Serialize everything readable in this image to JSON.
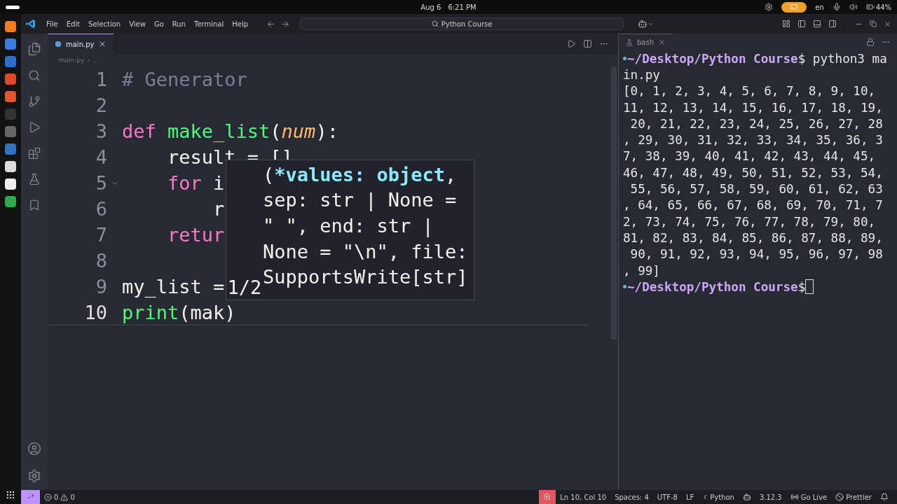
{
  "system_bar": {
    "date": "Aug 6",
    "time": "6:21 PM",
    "language": "en",
    "battery": "44%"
  },
  "menu": [
    "File",
    "Edit",
    "Selection",
    "View",
    "Go",
    "Run",
    "Terminal",
    "Help"
  ],
  "command_center": "Python Course",
  "editor": {
    "tabs": [
      {
        "label": "main.py",
        "selected": true
      }
    ],
    "breadcrumb": [
      "main.py",
      "›",
      "…"
    ],
    "lines": [
      {
        "number": "1",
        "tokens": [
          {
            "text": "# Generator",
            "kind": "comment"
          }
        ]
      },
      {
        "number": "2"
      },
      {
        "number": "3",
        "tokens": [
          {
            "text": "def ",
            "kind": "keyword"
          },
          {
            "text": "make_list",
            "kind": "function"
          },
          {
            "text": "(",
            "kind": "plain"
          },
          {
            "text": "num",
            "kind": "param"
          },
          {
            "text": "):",
            "kind": "plain"
          }
        ]
      },
      {
        "number": "4",
        "tokens": [
          {
            "text": "    result = []",
            "kind": "plain"
          }
        ]
      },
      {
        "number": "5",
        "fold": true,
        "tokens": [
          {
            "text": "    for ",
            "kind": "keyword"
          },
          {
            "text": "i",
            "kind": "plain"
          }
        ]
      },
      {
        "number": "6",
        "tokens": [
          {
            "text": "        r",
            "kind": "plain"
          }
        ]
      },
      {
        "number": "7",
        "tokens": [
          {
            "text": "    retur",
            "kind": "keyword"
          }
        ]
      },
      {
        "number": "8"
      },
      {
        "number": "9",
        "tokens": [
          {
            "text": "my_list =",
            "kind": "plain"
          }
        ]
      },
      {
        "number": "10",
        "current": true,
        "tokens": [
          {
            "text": "print",
            "kind": "function"
          },
          {
            "text": "(mak)",
            "kind": "plain"
          }
        ]
      }
    ],
    "hint": {
      "counter": "1/2",
      "lines": [
        [
          {
            "text": "(",
            "kind": "plain"
          },
          {
            "text": "*values: object",
            "kind": "active"
          },
          {
            "text": ",",
            "kind": "plain"
          }
        ],
        [
          {
            "text": "sep: str | None =",
            "kind": "plain"
          }
        ],
        [
          {
            "text": "\" \", end: str |",
            "kind": "plain"
          }
        ],
        [
          {
            "text": "None = \"\\n\", file:",
            "kind": "plain"
          }
        ],
        [
          {
            "text": "SupportsWrite[str]",
            "kind": "plain"
          }
        ]
      ]
    }
  },
  "terminal": {
    "tab": "bash",
    "lines": [
      {
        "kind": "prompt",
        "path": "~/Desktop/Python Course",
        "symbol": "$",
        "command": " python3 ma"
      },
      {
        "kind": "output",
        "text": "in.py"
      },
      {
        "kind": "output",
        "text": "[0, 1, 2, 3, 4, 5, 6, 7, 8, 9, 10,"
      },
      {
        "kind": "output",
        "text": "11, 12, 13, 14, 15, 16, 17, 18, 19,"
      },
      {
        "kind": "output",
        "text": " 20, 21, 22, 23, 24, 25, 26, 27, 28"
      },
      {
        "kind": "output",
        "text": ", 29, 30, 31, 32, 33, 34, 35, 36, 3"
      },
      {
        "kind": "output",
        "text": "7, 38, 39, 40, 41, 42, 43, 44, 45,"
      },
      {
        "kind": "output",
        "text": "46, 47, 48, 49, 50, 51, 52, 53, 54,"
      },
      {
        "kind": "output",
        "text": " 55, 56, 57, 58, 59, 60, 61, 62, 63"
      },
      {
        "kind": "output",
        "text": ", 64, 65, 66, 67, 68, 69, 70, 71, 7"
      },
      {
        "kind": "output",
        "text": "2, 73, 74, 75, 76, 77, 78, 79, 80,"
      },
      {
        "kind": "output",
        "text": "81, 82, 83, 84, 85, 86, 87, 88, 89,"
      },
      {
        "kind": "output",
        "text": " 90, 91, 92, 93, 94, 95, 96, 97, 98"
      },
      {
        "kind": "output",
        "text": ", 99]"
      },
      {
        "kind": "prompt",
        "path": "~/Desktop/Python Course",
        "symbol": "$",
        "cursor": true
      }
    ]
  },
  "status_bar": {
    "errors": "0",
    "warnings": "0",
    "items": [
      {
        "kind": "zoom"
      },
      {
        "kind": "text",
        "text": "Ln 10, Col 10"
      },
      {
        "kind": "text",
        "text": "Spaces: 4"
      },
      {
        "kind": "text",
        "text": "UTF-8"
      },
      {
        "kind": "text",
        "text": "LF"
      },
      {
        "kind": "language",
        "text": "Python"
      },
      {
        "kind": "copilot"
      },
      {
        "kind": "text",
        "text": "3.12.3"
      },
      {
        "kind": "live",
        "text": "Go Live"
      },
      {
        "kind": "prettier",
        "text": "Prettier"
      },
      {
        "kind": "bell"
      }
    ]
  }
}
